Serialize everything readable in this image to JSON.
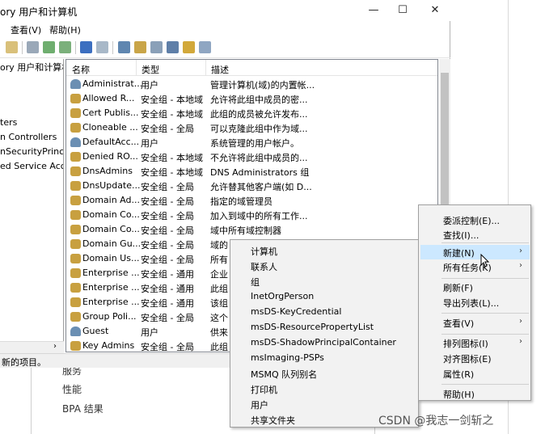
{
  "window": {
    "title": "ory 用户和计算机",
    "minimize": "—",
    "maximize": "☐",
    "close": "✕"
  },
  "menubar": {
    "view": "查看(V)",
    "help": "帮助(H)"
  },
  "tree": {
    "items": [
      "ory 用户和计算机",
      "ters",
      "n Controllers",
      "nSecurityPrincipal",
      "ed Service Acco"
    ]
  },
  "list": {
    "headers": {
      "name": "名称",
      "type": "类型",
      "desc": "描述"
    },
    "rows": [
      {
        "name": "Administrat...",
        "type": "用户",
        "desc": "管理计算机(域)的内置帐...",
        "icon": "user-icon"
      },
      {
        "name": "Allowed R...",
        "type": "安全组 - 本地域",
        "desc": "允许将此组中成员的密...",
        "icon": "group-icon"
      },
      {
        "name": "Cert Publis...",
        "type": "安全组 - 本地域",
        "desc": "此组的成员被允许发布...",
        "icon": "group-icon"
      },
      {
        "name": "Cloneable ...",
        "type": "安全组 - 全局",
        "desc": "可以克隆此组中作为域...",
        "icon": "group-icon"
      },
      {
        "name": "DefaultAcc...",
        "type": "用户",
        "desc": "系统管理的用户帐户。",
        "icon": "user-icon"
      },
      {
        "name": "Denied RO...",
        "type": "安全组 - 本地域",
        "desc": "不允许将此组中成员的...",
        "icon": "group-icon"
      },
      {
        "name": "DnsAdmins",
        "type": "安全组 - 本地域",
        "desc": "DNS Administrators 组",
        "icon": "group-icon"
      },
      {
        "name": "DnsUpdate...",
        "type": "安全组 - 全局",
        "desc": "允许替其他客户端(如 D...",
        "icon": "group-icon"
      },
      {
        "name": "Domain Ad...",
        "type": "安全组 - 全局",
        "desc": "指定的域管理员",
        "icon": "group-icon"
      },
      {
        "name": "Domain Co...",
        "type": "安全组 - 全局",
        "desc": "加入到域中的所有工作...",
        "icon": "group-icon"
      },
      {
        "name": "Domain Co...",
        "type": "安全组 - 全局",
        "desc": "域中所有域控制器",
        "icon": "group-icon"
      },
      {
        "name": "Domain Gu...",
        "type": "安全组 - 全局",
        "desc": "域的",
        "icon": "group-icon"
      },
      {
        "name": "Domain Us...",
        "type": "安全组 - 全局",
        "desc": "所有",
        "icon": "group-icon"
      },
      {
        "name": "Enterprise ...",
        "type": "安全组 - 通用",
        "desc": "企业",
        "icon": "group-icon"
      },
      {
        "name": "Enterprise ...",
        "type": "安全组 - 通用",
        "desc": "此组",
        "icon": "group-icon"
      },
      {
        "name": "Enterprise ...",
        "type": "安全组 - 通用",
        "desc": "该组",
        "icon": "group-icon"
      },
      {
        "name": "Group Poli...",
        "type": "安全组 - 全局",
        "desc": "这个",
        "icon": "group-icon"
      },
      {
        "name": "Guest",
        "type": "用户",
        "desc": "供来",
        "icon": "user-icon"
      },
      {
        "name": "Key Admins",
        "type": "安全组 - 全局",
        "desc": "此组",
        "icon": "group-icon"
      }
    ]
  },
  "status": {
    "text": "新的项目。"
  },
  "background": {
    "item1": "服务",
    "item2": "性能",
    "item3": "BPA 结果"
  },
  "context_menu": {
    "items": [
      {
        "label": "委派控制(E)...",
        "submenu": false
      },
      {
        "label": "查找(I)...",
        "submenu": false
      },
      {
        "label": "新建(N)",
        "submenu": true,
        "highlighted": true
      },
      {
        "label": "所有任务(K)",
        "submenu": true
      },
      {
        "label": "刷新(F)",
        "submenu": false
      },
      {
        "label": "导出列表(L)...",
        "submenu": false
      },
      {
        "label": "查看(V)",
        "submenu": true
      },
      {
        "label": "排列图标(I)",
        "submenu": true
      },
      {
        "label": "对齐图标(E)",
        "submenu": false
      },
      {
        "label": "属性(R)",
        "submenu": false
      },
      {
        "label": "帮助(H)",
        "submenu": false
      }
    ]
  },
  "new_submenu": {
    "items": [
      "计算机",
      "联系人",
      "组",
      "InetOrgPerson",
      "msDS-KeyCredential",
      "msDS-ResourcePropertyList",
      "msDS-ShadowPrincipalContainer",
      "msImaging-PSPs",
      "MSMQ 队列别名",
      "打印机",
      "用户",
      "共享文件夹"
    ]
  },
  "watermark": "CSDN @我志一剑斩之",
  "colors": {
    "highlight": "#cce8ff",
    "user_icon": "#6b8fb3",
    "group_icon": "#c8a040"
  }
}
